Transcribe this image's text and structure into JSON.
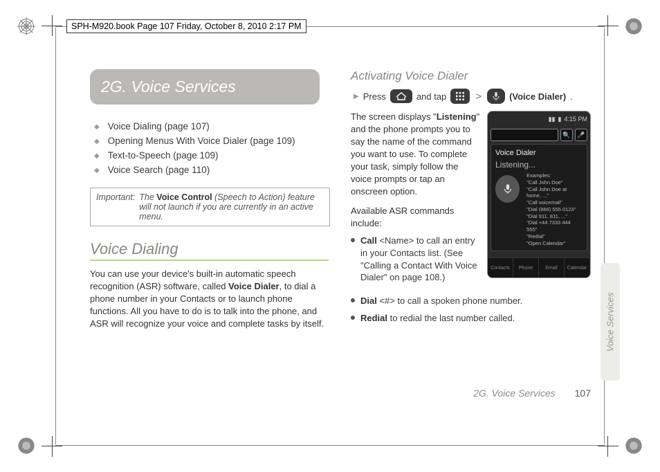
{
  "framemaker_header": "SPH-M920.book  Page 107  Friday, October 8, 2010  2:17 PM",
  "left": {
    "section_title": "2G. Voice Services",
    "toc": [
      "Voice Dialing (page 107)",
      "Opening Menus With Voice Dialer (page 109)",
      "Text-to-Speech (page 109)",
      "Voice Search (page 110)"
    ],
    "important_label": "Important:",
    "important_text_1": "The ",
    "important_bold": "Voice Control",
    "important_text_2": " (Speech to Action) feature will not launch if you are currently in an active menu.",
    "h_voice_dialing": "Voice Dialing",
    "p_voice_dialing_1": "You can use your device's built-in automatic speech recognition (ASR) software, called ",
    "p_voice_dialing_bold": "Voice Dialer",
    "p_voice_dialing_2": ", to dial a phone number in your Contacts or to launch phone functions. All you have to do is to talk into the phone, and ASR will recognize your voice and complete tasks by itself."
  },
  "right": {
    "h_activating": "Activating Voice Dialer",
    "step_press": "Press",
    "step_andtap": "and tap",
    "step_gt": ">",
    "step_app_bold": "(Voice Dialer)",
    "step_dot": ".",
    "p_screen_1": "The screen displays \"",
    "p_screen_bold": "Listening",
    "p_screen_2": "\" and the phone prompts you to say the name of the command you want to use. To complete your task, simply follow the voice prompts or tap an onscreen option.",
    "p_avail": "Available ASR commands include:",
    "bullets": [
      {
        "b": "Call",
        "rest1": " <Name> to call an entry in your Contacts list. (See \"Calling a Contact With Voice Dialer\" on page 108.)"
      },
      {
        "b": "Dial",
        "rest1": " <#> to call a spoken phone number."
      },
      {
        "b": "Redial",
        "rest1": " to redial the last number called."
      }
    ],
    "phone": {
      "time": "4:15 PM",
      "title": "Voice Dialer",
      "listening": "Listening...",
      "examples_label": "Examples:",
      "examples": [
        "\"Call John Doe\"",
        "\"Call John Doe at home, ...\"",
        "\"Call voicemail\"",
        "\"Dial (866) 555 0123\"",
        "\"Dial 911, 811, ...\"",
        "\"Dial +44 7333 444 555\"",
        "\"Redial\"",
        "\"Open Calendar\""
      ],
      "dock": [
        "Contacts",
        "Phone",
        "Email",
        "Calendar"
      ]
    }
  },
  "footer_label": "2G. Voice Services",
  "footer_page": "107",
  "sidetab": "Voice Services"
}
